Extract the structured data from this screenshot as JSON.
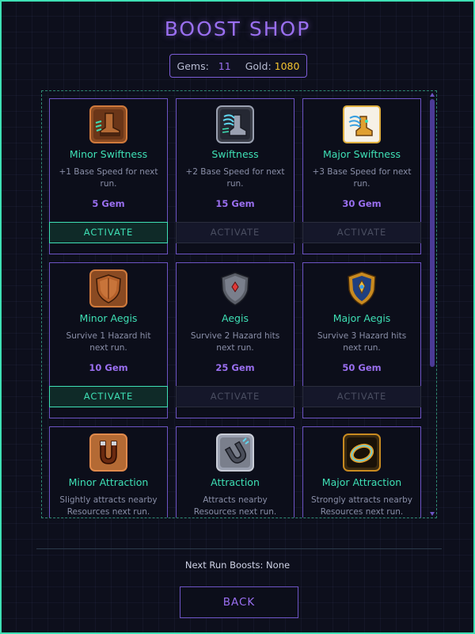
{
  "title": "BOOST SHOP",
  "currency": {
    "gems_label": "Gems:",
    "gems_value": "11",
    "gold_label": "Gold:",
    "gold_value": "1080"
  },
  "cards": [
    {
      "name": "Minor Swiftness",
      "desc": "+1 Base Speed for next run.",
      "cost": "5 Gem",
      "button": "ACTIVATE",
      "enabled": true,
      "icon": "boot-icon"
    },
    {
      "name": "Swiftness",
      "desc": "+2 Base Speed for next run.",
      "cost": "15 Gem",
      "button": "ACTIVATE",
      "enabled": false,
      "icon": "winged-boot-icon"
    },
    {
      "name": "Major Swiftness",
      "desc": "+3 Base Speed for next run.",
      "cost": "30 Gem",
      "button": "ACTIVATE",
      "enabled": false,
      "icon": "golden-winged-boot-icon"
    },
    {
      "name": "Minor Aegis",
      "desc": "Survive 1 Hazard hit next run.",
      "cost": "10 Gem",
      "button": "ACTIVATE",
      "enabled": true,
      "icon": "wooden-shield-icon"
    },
    {
      "name": "Aegis",
      "desc": "Survive 2 Hazard hits next run.",
      "cost": "25 Gem",
      "button": "ACTIVATE",
      "enabled": false,
      "icon": "steel-shield-icon"
    },
    {
      "name": "Major Aegis",
      "desc": "Survive 3 Hazard hits next run.",
      "cost": "50 Gem",
      "button": "ACTIVATE",
      "enabled": false,
      "icon": "golden-shield-icon"
    },
    {
      "name": "Minor Attraction",
      "desc": "Slightly attracts nearby Resources next run.",
      "cost": "",
      "button": "",
      "enabled": false,
      "icon": "copper-magnet-icon"
    },
    {
      "name": "Attraction",
      "desc": "Attracts nearby Resources next run.",
      "cost": "",
      "button": "",
      "enabled": false,
      "icon": "steel-magnet-icon"
    },
    {
      "name": "Major Attraction",
      "desc": "Strongly attracts nearby Resources next run.",
      "cost": "",
      "button": "",
      "enabled": false,
      "icon": "golden-magnet-icon"
    }
  ],
  "status": "Next Run Boosts: None",
  "back_label": "BACK",
  "colors": {
    "accent_teal": "#3ee0b5",
    "accent_purple": "#9a6ff0",
    "gold": "#f4c430",
    "background": "#0d0f1c"
  }
}
